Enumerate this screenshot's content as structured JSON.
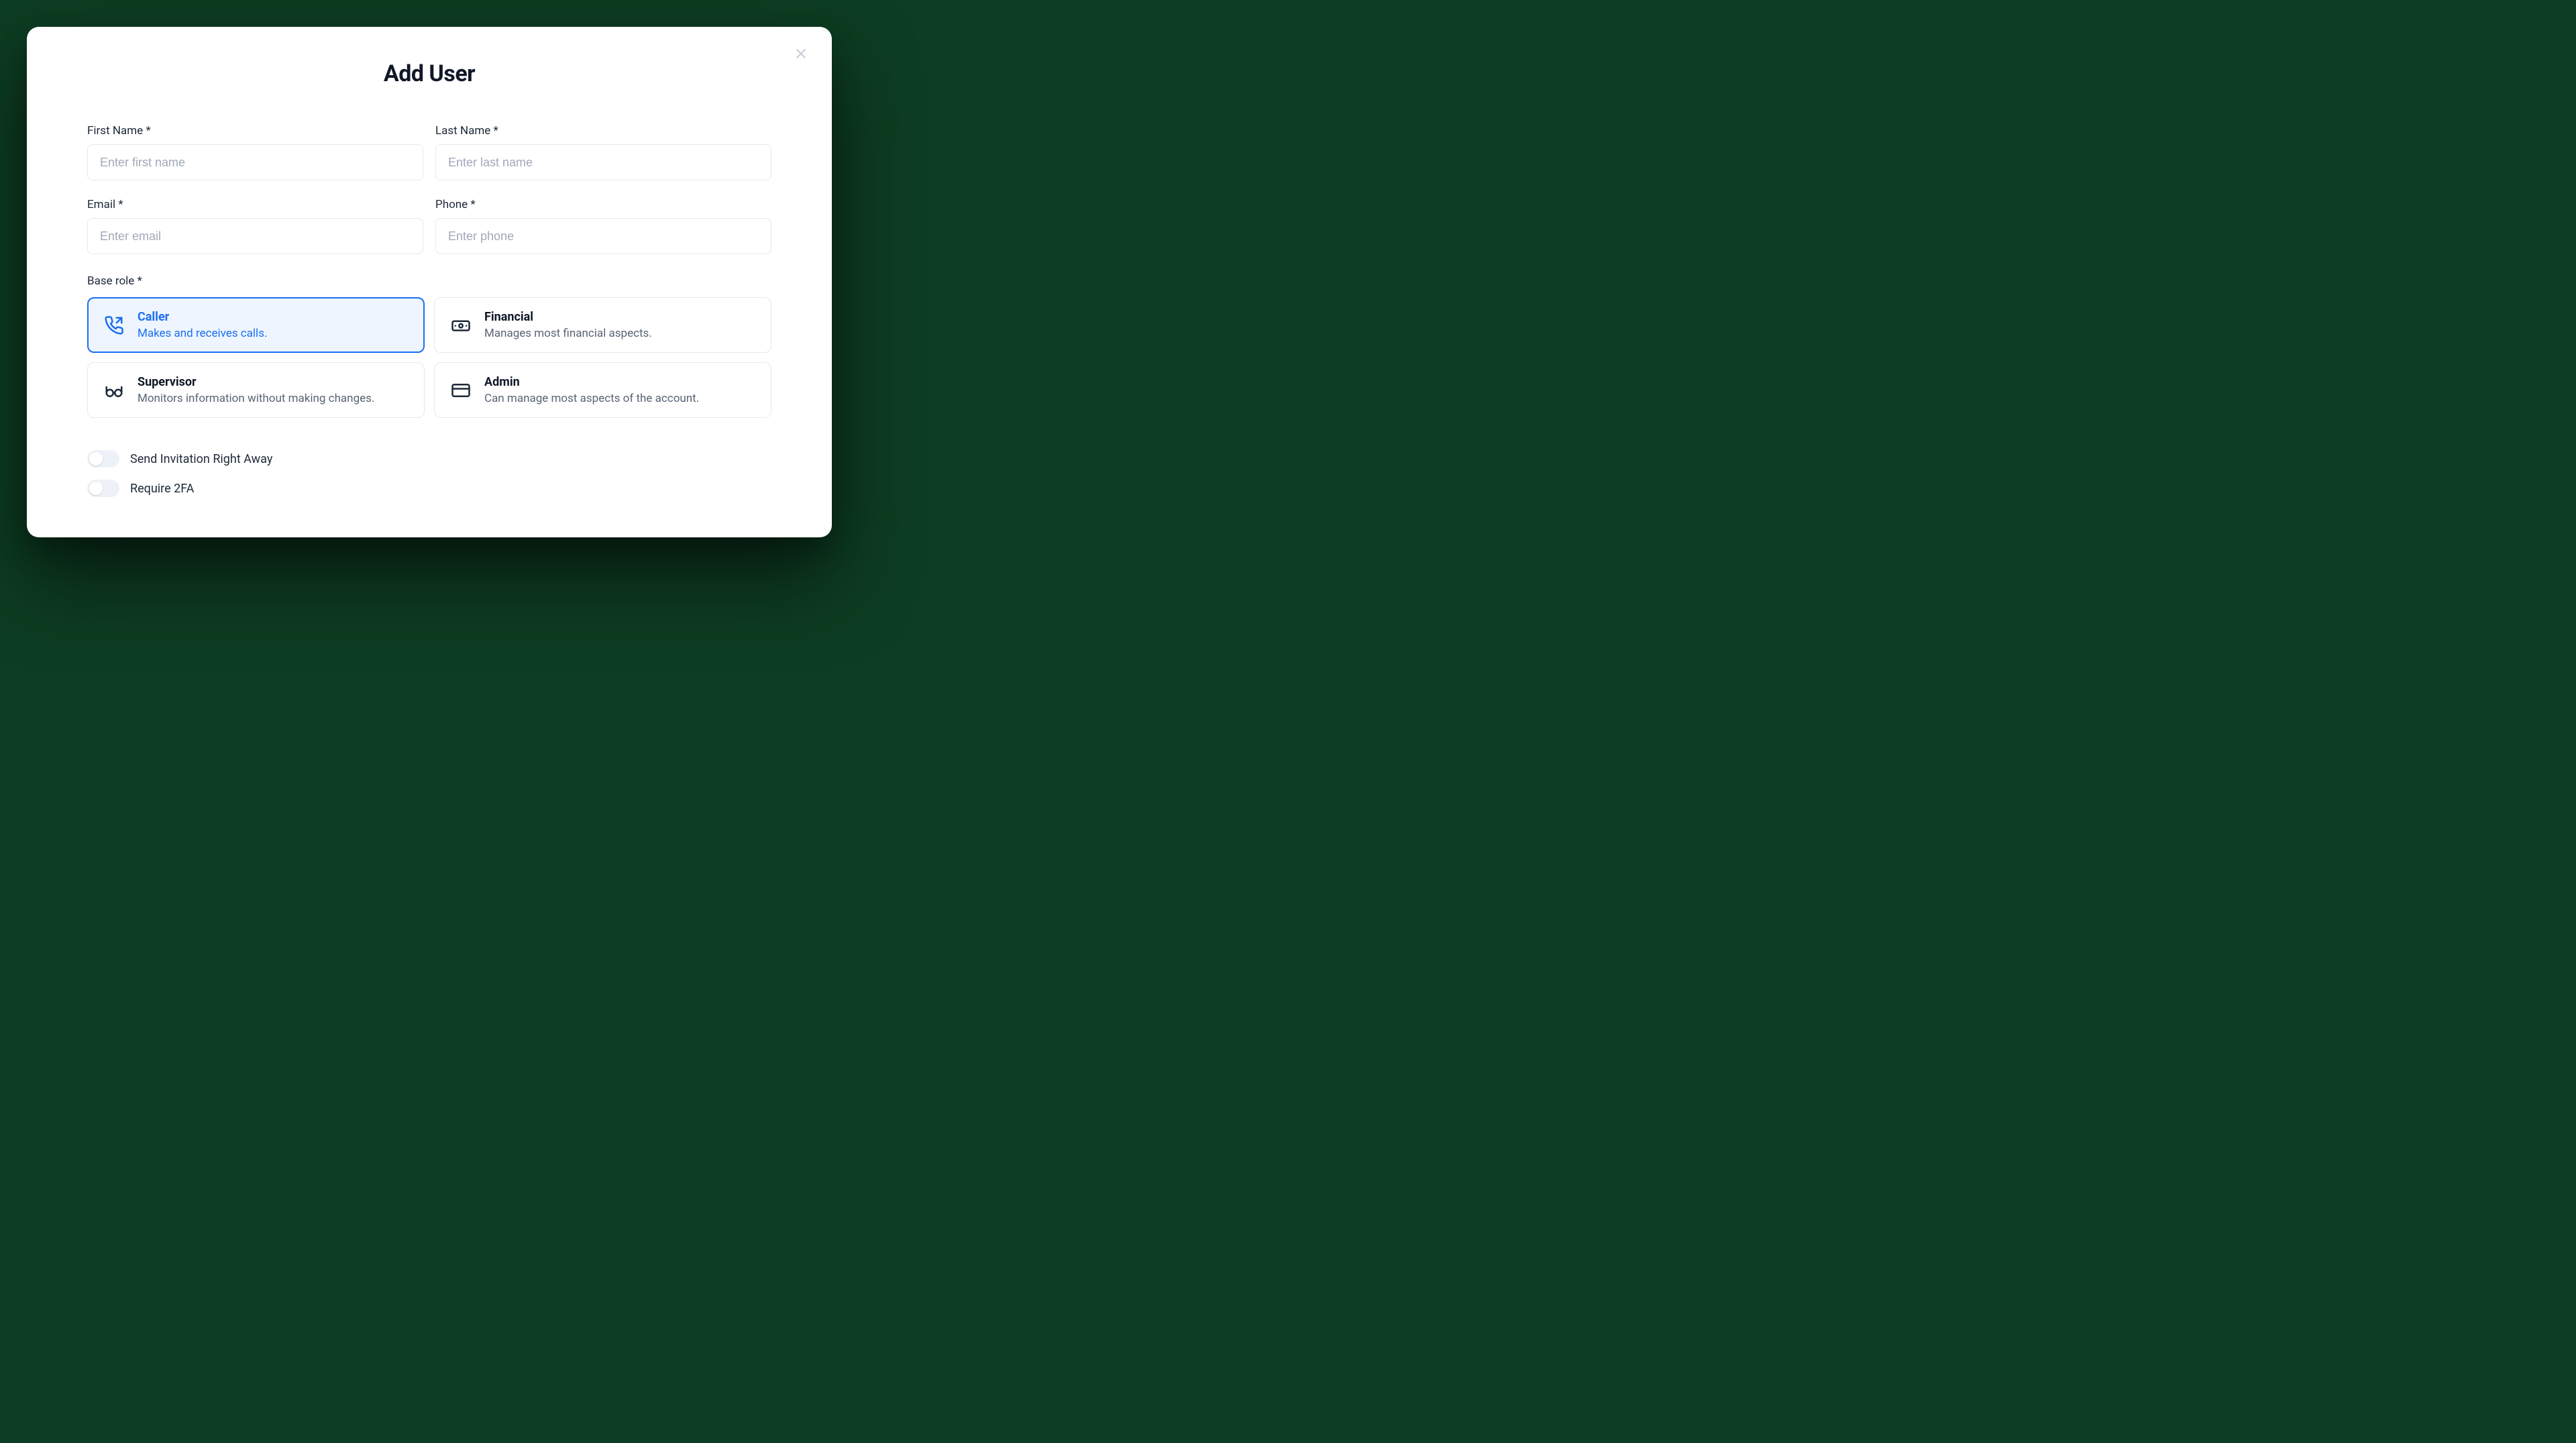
{
  "modal": {
    "title": "Add User",
    "fields": {
      "first_name": {
        "label": "First Name *",
        "placeholder": "Enter first name",
        "value": ""
      },
      "last_name": {
        "label": "Last Name *",
        "placeholder": "Enter last name",
        "value": ""
      },
      "email": {
        "label": "Email *",
        "placeholder": "Enter email",
        "value": ""
      },
      "phone": {
        "label": "Phone *",
        "placeholder": "Enter phone",
        "value": ""
      }
    },
    "base_role_label": "Base role *",
    "roles": [
      {
        "title": "Caller",
        "desc": "Makes and receives calls.",
        "selected": true
      },
      {
        "title": "Financial",
        "desc": "Manages most financial aspects.",
        "selected": false
      },
      {
        "title": "Supervisor",
        "desc": "Monitors information without making changes.",
        "selected": false
      },
      {
        "title": "Admin",
        "desc": "Can manage most aspects of the account.",
        "selected": false
      }
    ],
    "switches": [
      {
        "label": "Send Invitation Right Away",
        "on": false
      },
      {
        "label": "Require 2FA",
        "on": false
      }
    ]
  }
}
